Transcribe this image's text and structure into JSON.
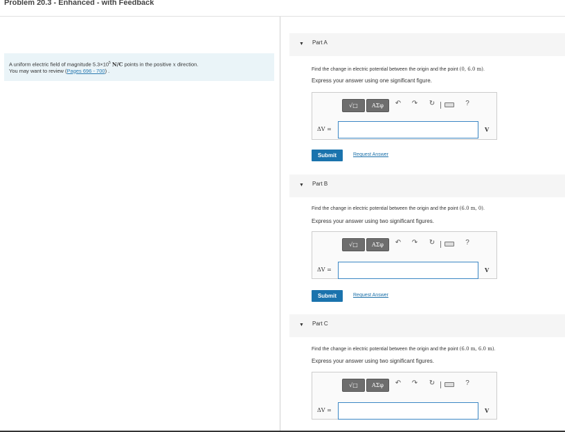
{
  "title": "Problem 20.3 - Enhanced - with Feedback",
  "intro": {
    "line1_a": "A uniform electric field of magnitude 5.3×10",
    "line1_exp": "5",
    "line1_unit": "N/C",
    "line1_b": " points in the positive ",
    "line1_var": "x",
    "line1_c": " direction.",
    "line2_a": "You may want to review (",
    "link": "Pages 696 - 700",
    "line2_b": ") ."
  },
  "toolbar": {
    "template_label": "√□",
    "greek_label": "ΑΣφ",
    "help_label": "?"
  },
  "parts": [
    {
      "label": "Part A",
      "question_a": "Find the change in electric potential between the origin and the point ",
      "question_math": "(0, 6.0 m)",
      "question_b": ".",
      "instruction": "Express your answer using one significant figure.",
      "answer_label": "ΔV =",
      "answer_value": "",
      "unit": "V",
      "submit": "Submit",
      "request": "Request Answer"
    },
    {
      "label": "Part B",
      "question_a": "Find the change in electric potential between the origin and the point ",
      "question_math": "(6.0 m, 0)",
      "question_b": ".",
      "instruction": "Express your answer using two significant figures.",
      "answer_label": "ΔV =",
      "answer_value": "",
      "unit": "V",
      "submit": "Submit",
      "request": "Request Answer"
    },
    {
      "label": "Part C",
      "question_a": "Find the change in electric potential between the origin and the point ",
      "question_math": "(6.0 m, 6.0 m)",
      "question_b": ".",
      "instruction": "Express your answer using two significant figures.",
      "answer_label": "ΔV =",
      "answer_value": "",
      "unit": "V"
    }
  ]
}
